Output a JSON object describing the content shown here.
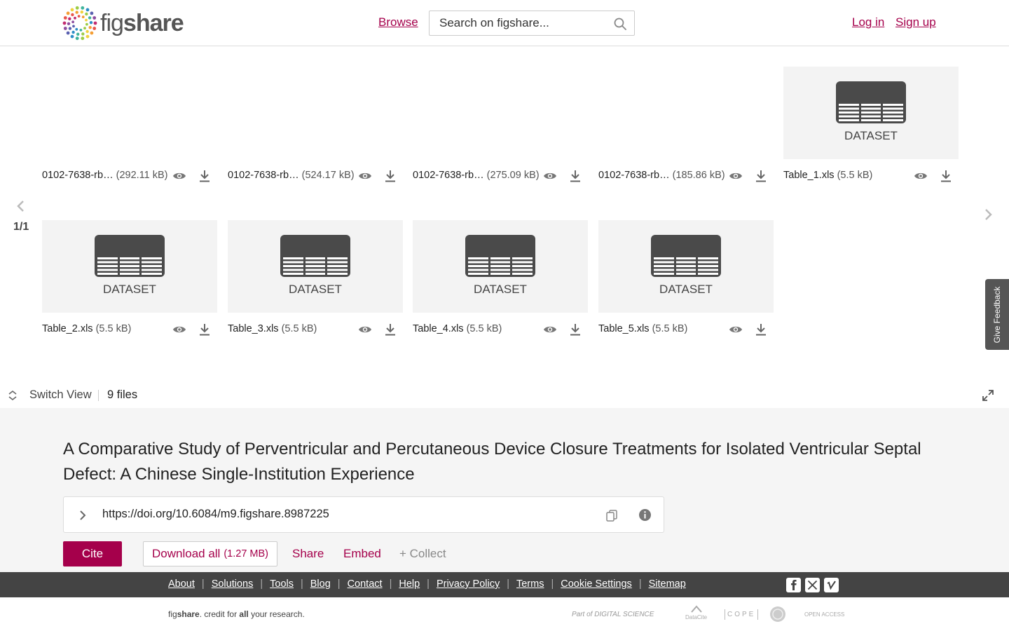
{
  "header": {
    "logo_text_light": "fig",
    "logo_text_bold": "share",
    "browse_label": "Browse",
    "search_placeholder": "Search on figshare...",
    "login_label": "Log in",
    "signup_label": "Sign up"
  },
  "gallery": {
    "pager": "1/1",
    "feedback_label": "Give Feedback",
    "files": [
      {
        "name": "0102-7638-rb…",
        "size": "(292.11 kB)",
        "thumb": ""
      },
      {
        "name": "0102-7638-rb…",
        "size": "(524.17 kB)",
        "thumb": ""
      },
      {
        "name": "0102-7638-rb…",
        "size": "(275.09 kB)",
        "thumb": ""
      },
      {
        "name": "0102-7638-rb…",
        "size": "(185.86 kB)",
        "thumb": ""
      },
      {
        "name": "Table_1.xls",
        "size": "(5.5 kB)",
        "thumb": "DATASET"
      },
      {
        "name": "Table_2.xls",
        "size": "(5.5 kB)",
        "thumb": "DATASET"
      },
      {
        "name": "Table_3.xls",
        "size": "(5.5 kB)",
        "thumb": "DATASET"
      },
      {
        "name": "Table_4.xls",
        "size": "(5.5 kB)",
        "thumb": "DATASET"
      },
      {
        "name": "Table_5.xls",
        "size": "(5.5 kB)",
        "thumb": "DATASET"
      }
    ],
    "switch_view_label": "Switch View",
    "files_count": "9 files"
  },
  "article": {
    "title": "A Comparative Study of Perventricular and Percutaneous Device Closure Treatments for Isolated Ventricular Septal Defect: A Chinese Single-Institution Experience",
    "doi": "https://doi.org/10.6084/m9.figshare.8987225",
    "cite_label": "Cite",
    "download_all_label": "Download all",
    "download_all_size": "(1.27 MB)",
    "share_label": "Share",
    "embed_label": "Embed",
    "collect_label": "+ Collect"
  },
  "footer": {
    "links": [
      "About",
      "Solutions",
      "Tools",
      "Blog",
      "Contact",
      "Help",
      "Privacy Policy",
      "Terms",
      "Cookie Settings",
      "Sitemap"
    ],
    "tagline_fig": "fig",
    "tagline_share": "share",
    "tagline_mid": ". credit for ",
    "tagline_all": "all",
    "tagline_end": " your research.",
    "partners": [
      "Part of DIGITAL SCIENCE",
      "DataCite",
      "COPE",
      "OPEN ACCESS"
    ]
  },
  "colors": {
    "brand": "#a5004b",
    "footer_bg": "#444444",
    "details_bg": "#f5f5f5"
  }
}
